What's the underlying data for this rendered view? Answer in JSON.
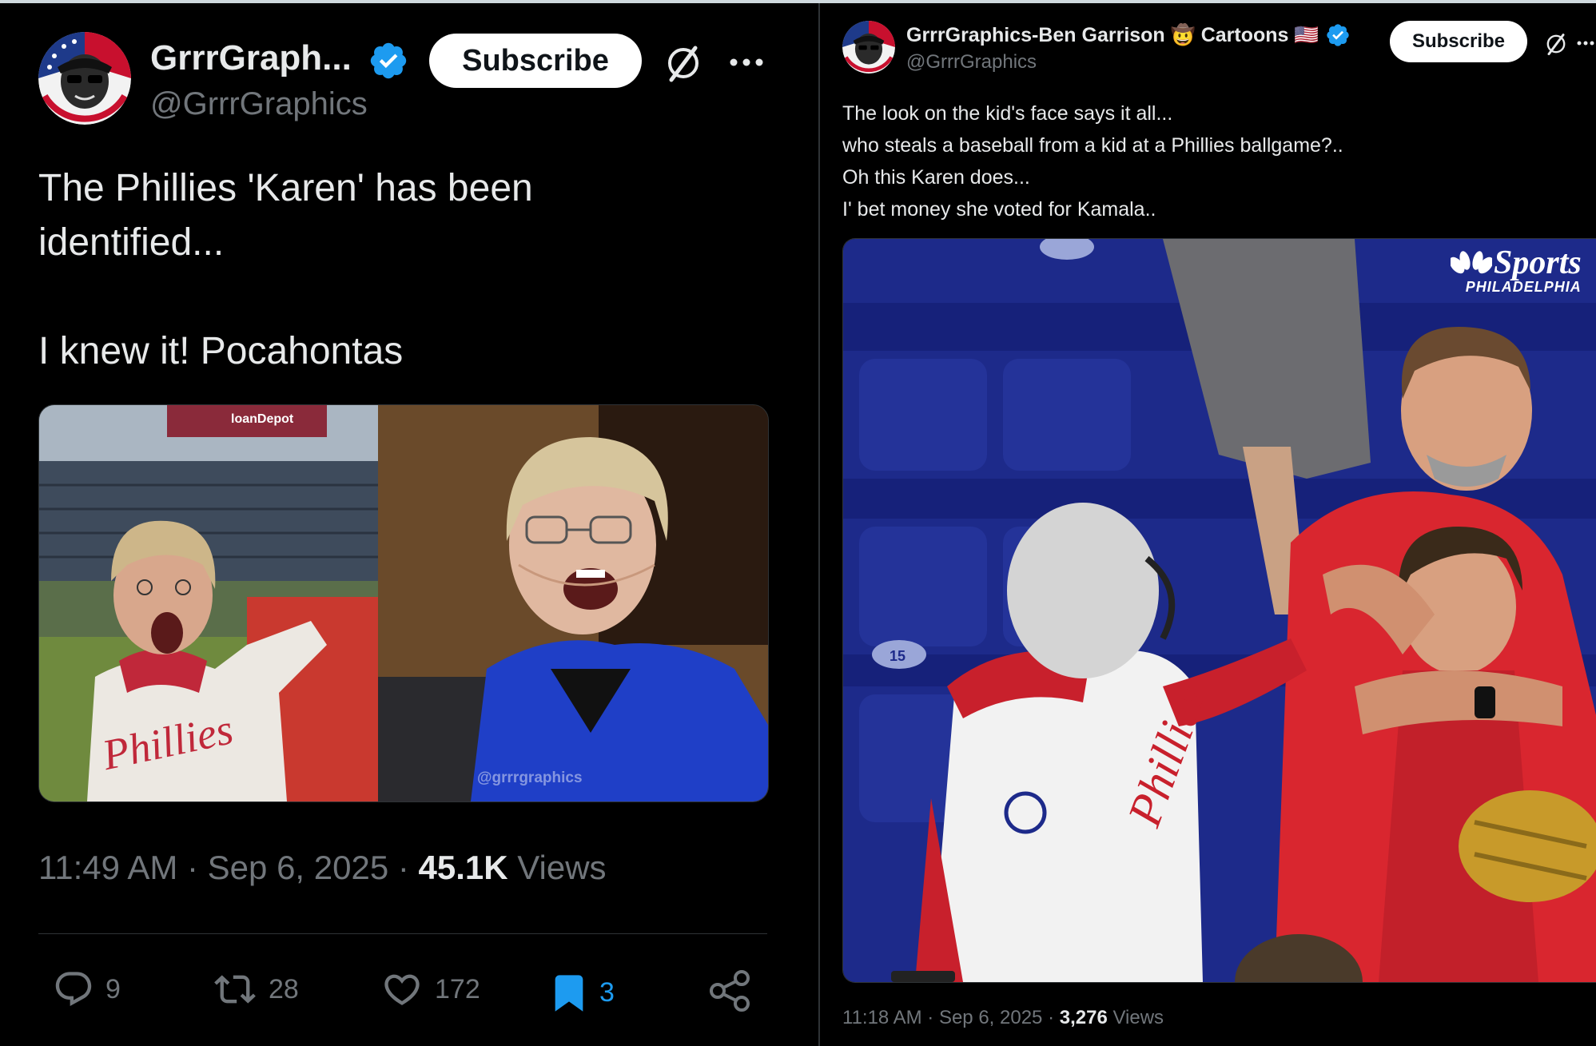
{
  "left_post": {
    "author_name": "GrrrGraph...",
    "handle": "@GrrrGraphics",
    "subscribe_label": "Subscribe",
    "text_lines": [
      "The Phillies 'Karen' has been",
      "identified...",
      "",
      "I knew it!  Pocahontas"
    ],
    "image_watermark": "@grrrgraphics",
    "image_sign_text": "loanDepot",
    "jersey_text": "Phillies",
    "time": "11:49 AM",
    "date": "Sep 6, 2025",
    "views_count": "45.1K",
    "views_label": "Views",
    "replies": "9",
    "reposts": "28",
    "likes": "172",
    "bookmarks": "3"
  },
  "right_post": {
    "author_name": "GrrrGraphics-Ben Garrison 🤠 Cartoons 🇺🇸",
    "handle": "@GrrrGraphics",
    "subscribe_label": "Subscribe",
    "text_lines": [
      "The look on the kid's face says it all...",
      "who steals a baseball from a kid at a Phillies ballgame?..",
      "Oh this Karen does...",
      "I' bet money she voted for Kamala.."
    ],
    "video_logo_line1": "Sports",
    "video_logo_line2": "PHILADELPHIA",
    "seat_number_1": "15",
    "time": "11:18 AM",
    "date": "Sep 6, 2025",
    "views_count": "3,276",
    "views_label": "Views"
  },
  "colors": {
    "background": "#000000",
    "text": "#e7e9ea",
    "muted": "#71767b",
    "verified_blue": "#1d9bf0",
    "bookmark_active": "#1d9bf0"
  },
  "icons": [
    "verified-badge-icon",
    "grok-icon",
    "more-icon",
    "reply-icon",
    "repost-icon",
    "like-icon",
    "bookmark-icon",
    "share-icon"
  ]
}
